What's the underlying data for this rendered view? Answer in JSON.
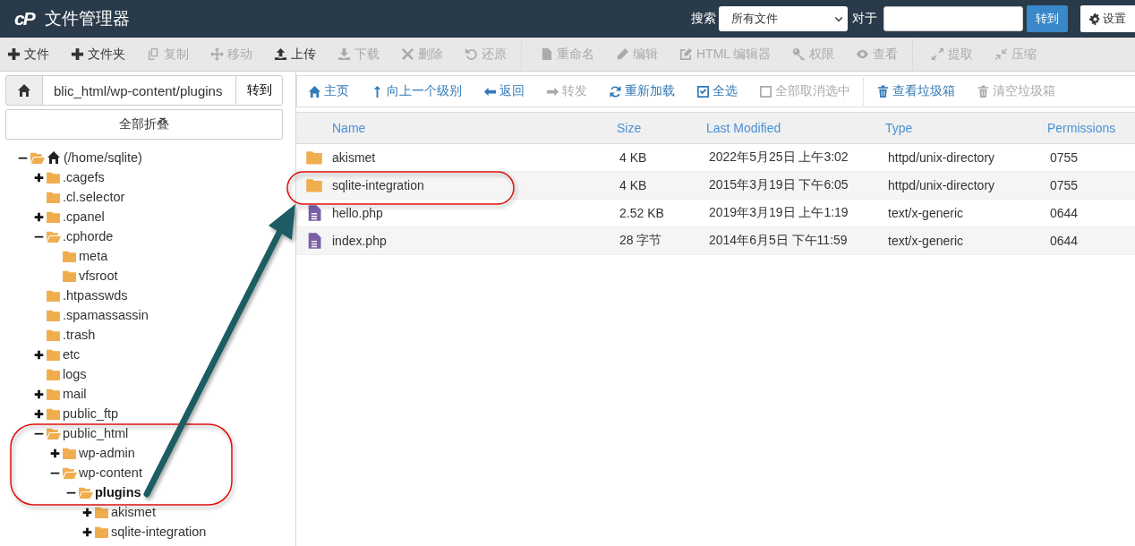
{
  "header": {
    "logo": "cP",
    "title": "文件管理器",
    "search_label": "搜索",
    "search_scope": "所有文件",
    "for_label": "对于",
    "go_button": "转到",
    "settings_button": "设置"
  },
  "toolbar": [
    [
      {
        "label": "文件",
        "disabled": false
      },
      {
        "label": "文件夹",
        "disabled": false
      },
      {
        "label": "复制",
        "disabled": true
      },
      {
        "label": "移动",
        "disabled": true
      },
      {
        "label": "上传",
        "disabled": false
      },
      {
        "label": "下载",
        "disabled": true
      },
      {
        "label": "删除",
        "disabled": true
      },
      {
        "label": "还原",
        "disabled": true
      }
    ],
    [
      {
        "label": "重命名",
        "disabled": true
      },
      {
        "label": "编辑",
        "disabled": true
      },
      {
        "label": "HTML 编辑器",
        "disabled": true
      },
      {
        "label": "权限",
        "disabled": true
      },
      {
        "label": "查看",
        "disabled": true
      }
    ],
    [
      {
        "label": "提取",
        "disabled": true
      },
      {
        "label": "压缩",
        "disabled": true
      }
    ]
  ],
  "path_bar": {
    "path": "blic_html/wp-content/plugins",
    "go_button": "转到"
  },
  "collapse_all": "全部折叠",
  "tree": [
    {
      "label": "(/home/sqlite)",
      "home": true,
      "expandable": true,
      "expanded": true,
      "selected": false,
      "children": [
        {
          "label": ".cagefs",
          "expandable": true,
          "expanded": false,
          "selected": false
        },
        {
          "label": ".cl.selector",
          "expandable": false,
          "expanded": false,
          "selected": false
        },
        {
          "label": ".cpanel",
          "expandable": true,
          "expanded": false,
          "selected": false
        },
        {
          "label": ".cphorde",
          "expandable": true,
          "expanded": true,
          "selected": false,
          "children": [
            {
              "label": "meta",
              "expandable": false,
              "expanded": false,
              "selected": false
            },
            {
              "label": "vfsroot",
              "expandable": false,
              "expanded": false,
              "selected": false
            }
          ]
        },
        {
          "label": ".htpasswds",
          "expandable": false,
          "expanded": false,
          "selected": false
        },
        {
          "label": ".spamassassin",
          "expandable": false,
          "expanded": false,
          "selected": false
        },
        {
          "label": ".trash",
          "expandable": false,
          "expanded": false,
          "selected": false
        },
        {
          "label": "etc",
          "expandable": true,
          "expanded": false,
          "selected": false
        },
        {
          "label": "logs",
          "expandable": false,
          "expanded": false,
          "selected": false
        },
        {
          "label": "mail",
          "expandable": true,
          "expanded": false,
          "selected": false
        },
        {
          "label": "public_ftp",
          "expandable": true,
          "expanded": false,
          "selected": false
        },
        {
          "label": "public_html",
          "expandable": true,
          "expanded": true,
          "selected": false,
          "children": [
            {
              "label": "wp-admin",
              "expandable": true,
              "expanded": false,
              "selected": false
            },
            {
              "label": "wp-content",
              "expandable": true,
              "expanded": true,
              "selected": false,
              "children": [
                {
                  "label": "plugins",
                  "expandable": true,
                  "expanded": true,
                  "selected": true,
                  "children": [
                    {
                      "label": "akismet",
                      "expandable": true,
                      "expanded": false,
                      "selected": false
                    },
                    {
                      "label": "sqlite-integration",
                      "expandable": true,
                      "expanded": false,
                      "selected": false
                    }
                  ]
                }
              ]
            }
          ]
        }
      ]
    }
  ],
  "nav": [
    [
      {
        "label": "主页",
        "disabled": false
      },
      {
        "label": "向上一个级别",
        "disabled": false
      },
      {
        "label": "返回",
        "disabled": false
      },
      {
        "label": "转发",
        "disabled": true
      },
      {
        "label": "重新加载",
        "disabled": false
      },
      {
        "label": "全选",
        "disabled": false
      },
      {
        "label": "全部取消选中",
        "disabled": true
      }
    ],
    [
      {
        "label": "查看垃圾箱",
        "disabled": false
      },
      {
        "label": "清空垃圾箱",
        "disabled": true
      }
    ]
  ],
  "table": {
    "columns": [
      "Name",
      "Size",
      "Last Modified",
      "Type",
      "Permissions"
    ],
    "rows": [
      {
        "kind": "folder",
        "name": "akismet",
        "size": "4 KB",
        "modified": "2022年5月25日 上午3:02",
        "type": "httpd/unix-directory",
        "permissions": "0755"
      },
      {
        "kind": "folder",
        "name": "sqlite-integration",
        "size": "4 KB",
        "modified": "2015年3月19日 下午6:05",
        "type": "httpd/unix-directory",
        "permissions": "0755"
      },
      {
        "kind": "file",
        "name": "hello.php",
        "size": "2.52 KB",
        "modified": "2019年3月19日 上午1:19",
        "type": "text/x-generic",
        "permissions": "0644"
      },
      {
        "kind": "file",
        "name": "index.php",
        "size": "28 字节",
        "modified": "2014年6月5日 下午11:59",
        "type": "text/x-generic",
        "permissions": "0644"
      }
    ]
  }
}
